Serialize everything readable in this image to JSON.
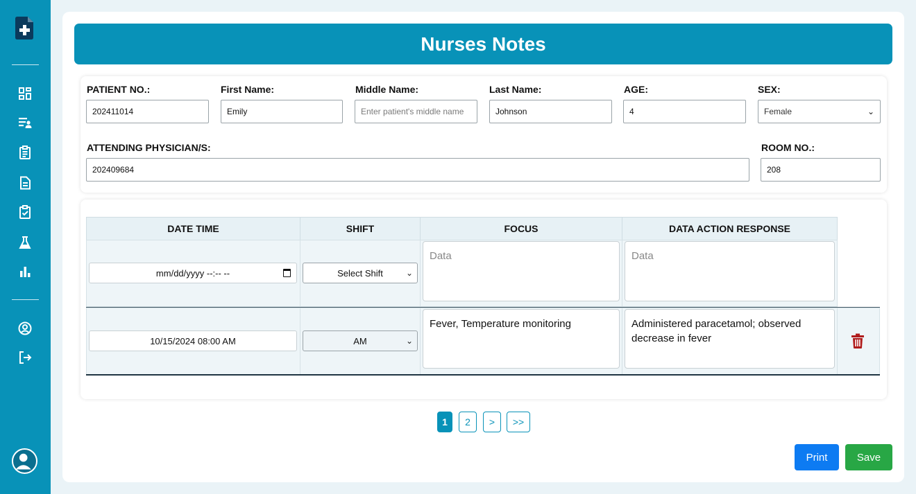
{
  "title": "Nurses Notes",
  "sidebar": {
    "items": [
      {
        "icon": "dashboard-icon"
      },
      {
        "icon": "patient-list-icon"
      },
      {
        "icon": "clipboard-icon"
      },
      {
        "icon": "document-icon"
      },
      {
        "icon": "clipboard-check-icon"
      },
      {
        "icon": "lab-flask-icon"
      },
      {
        "icon": "bar-chart-icon"
      },
      {
        "icon": "user-circle-icon"
      },
      {
        "icon": "logout-icon"
      }
    ]
  },
  "patient": {
    "patient_no_label": "PATIENT NO.:",
    "patient_no": "202411014",
    "first_name_label": "First Name:",
    "first_name": "Emily",
    "middle_name_label": "Middle Name:",
    "middle_name_placeholder": "Enter patient's middle name",
    "last_name_label": "Last Name:",
    "last_name": "Johnson",
    "age_label": "AGE:",
    "age": "4",
    "sex_label": "SEX:",
    "sex": "Female",
    "physician_label": "ATTENDING PHYSICIAN/S:",
    "physician": "202409684",
    "room_label": "ROOM NO.:",
    "room": "208"
  },
  "table": {
    "headers": [
      "DATE TIME",
      "SHIFT",
      "FOCUS",
      "DATA ACTION RESPONSE"
    ],
    "new_row": {
      "datetime_placeholder": "mm/dd/yyyy --:-- --",
      "shift_placeholder": "Select Shift",
      "focus_placeholder": "Data",
      "response_placeholder": "Data"
    },
    "rows": [
      {
        "datetime": "10/15/2024 08:00 AM",
        "shift": "AM",
        "focus": "Fever, Temperature monitoring",
        "response": "Administered paracetamol; observed decrease in fever"
      }
    ]
  },
  "pagination": {
    "pages": [
      "1",
      "2"
    ],
    "current": "1",
    "next": ">",
    "last": ">>"
  },
  "actions": {
    "print": "Print",
    "save": "Save"
  },
  "colors": {
    "primary": "#0892b8",
    "print": "#0d7bf2",
    "save": "#28a745",
    "danger": "#b01c1c"
  }
}
